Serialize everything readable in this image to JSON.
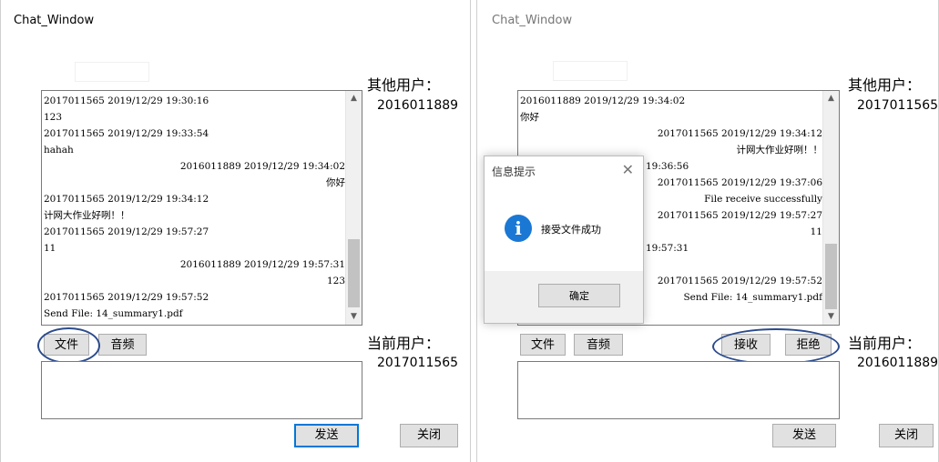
{
  "left_window": {
    "title": "Chat_Window",
    "other_user_label": "其他用户：",
    "other_user_id": "2016011889",
    "current_user_label": "当前用户：",
    "current_user_id": "2017011565",
    "file_button": "文件",
    "audio_button": "音频",
    "send_button": "发送",
    "close_button": "关闭",
    "chat_lines": [
      "2017011565 2019/12/29 19:30:16",
      "123",
      "2017011565 2019/12/29 19:33:54",
      "hahah",
      "2016011889 2019/12/29 19:34:02",
      "你好",
      "2017011565 2019/12/29 19:34:12",
      "计网大作业好咧！！",
      "2017011565 2019/12/29 19:57:27",
      "11",
      "2016011889 2019/12/29 19:57:31",
      "123",
      "2017011565 2019/12/29 19:57:52",
      "Send File: 14_summary1.pdf"
    ]
  },
  "right_window": {
    "title": "Chat_Window",
    "other_user_label": "其他用户：",
    "other_user_id": "2017011565",
    "current_user_label": "当前用户：",
    "current_user_id": "2016011889",
    "file_button": "文件",
    "audio_button": "音频",
    "receive_button": "接收",
    "reject_button": "拒绝",
    "send_button": "发送",
    "close_button": "关闭",
    "chat_lines": [
      "2016011889 2019/12/29 19:34:02",
      "你好",
      "2017011565 2019/12/29 19:34:12",
      "计网大作业好咧！！",
      "19:36:56",
      "2017011565  2019/12/29 19:37:06",
      "File receive successfully",
      "2017011565 2019/12/29 19:57:27",
      "11",
      "19:57:31",
      "2017011565 2019/12/29 19:57:52",
      "Send File: 14_summary1.pdf"
    ]
  },
  "dialog": {
    "title": "信息提示",
    "message": "接受文件成功",
    "ok_button": "确定",
    "info_glyph": "i"
  },
  "colors": {
    "annotation_oval": "#2b4b8c",
    "button_bg": "#e1e1e1",
    "focus_border": "#0078d7",
    "info_icon": "#1a78d4"
  }
}
